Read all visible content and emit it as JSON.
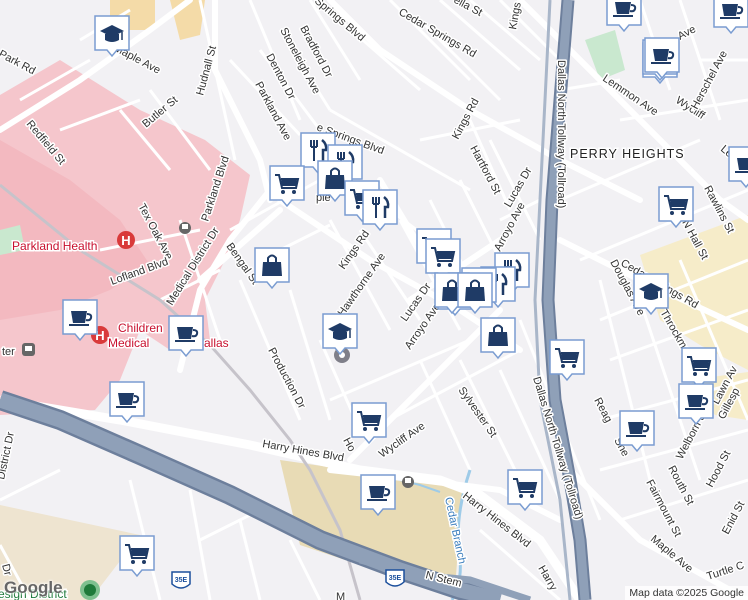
{
  "streets": {
    "cedar_springs_rd": "Cedar Springs Rd",
    "cedar_springs_rd_2": "Cedar Springs Rd",
    "dallas_north_tollway": "Dallas North Tollway (Tollroad)",
    "dallas_north_tollway_2": "Dallas North Tollway (Tollroad)",
    "harry_hines_blvd": "Harry Hines Blvd",
    "harry_hines_blvd_2": "Harry Hines Blvd",
    "harry_hines_blvd_3": "Harry",
    "maple_ave": "Maple Ave",
    "maple_ave_2": "Maple Ave",
    "lemmon_ave": "Lemmon Ave",
    "lemmon_ave_2": "Lem",
    "wycliff_ave": "Wycliff Ave",
    "wycliff_ave_2": "Wycliff",
    "kings_rd": "Kings Rd",
    "kings_rd_2": "Kings Rd",
    "kings_rd_3": "Kings R",
    "hawthorne_ave": "Hawthorne Ave",
    "lucas_dr": "Lucas Dr",
    "lucas_dr_2": "Lucas Dr",
    "arroyo_ave": "Arroyo Ave",
    "arroyo_ave_2": "Arroyo Ave",
    "sylvester_st": "Sylvester St",
    "production_dr": "Production Dr",
    "medical_district_dr": "Medical District Dr",
    "bengal_st": "Bengal St",
    "parkland_blvd": "Parkland Blvd",
    "parkland_ave": "Parkland Ave",
    "tex_oak_ave": "Tex Oak Ave",
    "lofland_blvd": "Lofland Blvd",
    "butler_st": "Butler St",
    "redfield_st": "Redfield St",
    "hudnall_st": "Hudnall St",
    "denton_dr": "Denton Dr",
    "stoneleigh_ave": "Stoneleigh Ave",
    "bradford_dr": "Bradford Dr",
    "springs_blvd": "Springs Blvd",
    "springs_blvd_2": "e Springs Blvd",
    "hartford_st": "Hartford St",
    "rawlins_st": "Rawlins St",
    "herschel_ave": "Herschel Ave",
    "douglas_ave": "Douglas Ave",
    "throckmorton_st": "Throckmorton St",
    "hall_st": "N Hall St",
    "reagan_st": "Reag",
    "welborn_st": "Welborn St",
    "routh_st": "Routh St",
    "hood_st": "Hood St",
    "fairmount_st": "Fairmount St",
    "enid_st": "Enid St",
    "turtle_creek": "Turtle C",
    "n_stemmons": "N Stem",
    "gillespie_st": "Gillesp",
    "lawn_ave": "Lawn Av",
    "sheridan_st": "She",
    "ho_st": "Ho",
    "ella_st": "ella St",
    "ave_top": "Ave",
    "park_rd": "Park Rd",
    "district_dr": "District Dr",
    "ter": "ter",
    "ple": "ple",
    "sign_district": "esign District",
    "dr_fragment": "Dr",
    "m_fragment": "M"
  },
  "areas": {
    "perry_heights": "PERRY HEIGHTS",
    "parkland_health": "Parkland Health",
    "childrens_medical": "Children's Medical Dallas",
    "childrens_line1": "Children",
    "childrens_line2": "Medical",
    "childrens_line3": "allas",
    "cedar_branch": "Cedar Branch",
    "google": "Google"
  },
  "shields": {
    "i35e_1": "35E",
    "i35e_2": "35E"
  },
  "markers": [
    {
      "type": "school",
      "icon": "graduation-cap-icon"
    },
    {
      "type": "coffee",
      "icon": "coffee-cup-icon"
    },
    {
      "type": "coffee",
      "icon": "coffee-cup-icon"
    },
    {
      "type": "shopping",
      "icon": "shopping-bag-icon"
    },
    {
      "type": "restaurant",
      "icon": "fork-knife-icon"
    },
    {
      "type": "grocery",
      "icon": "shopping-cart-icon"
    },
    {
      "type": "restaurant",
      "icon": "fork-knife-icon"
    },
    {
      "type": "shopping",
      "icon": "shopping-bag-icon"
    },
    {
      "type": "grocery",
      "icon": "shopping-cart-icon"
    },
    {
      "type": "restaurant",
      "icon": "fork-knife-icon"
    },
    {
      "type": "grocery",
      "icon": "shopping-cart-icon"
    },
    {
      "type": "restaurant",
      "icon": "fork-knife-icon"
    },
    {
      "type": "coffee",
      "icon": "coffee-cup-icon"
    },
    {
      "type": "coffee",
      "icon": "coffee-cup-icon"
    },
    {
      "type": "grocery",
      "icon": "shopping-cart-icon"
    },
    {
      "type": "shopping",
      "icon": "shopping-bag-icon"
    },
    {
      "type": "coffee",
      "icon": "coffee-cup-icon"
    },
    {
      "type": "coffee",
      "icon": "coffee-cup-icon"
    },
    {
      "type": "school",
      "icon": "graduation-cap-icon"
    },
    {
      "type": "shopping",
      "icon": "shopping-bag-icon"
    },
    {
      "type": "restaurant",
      "icon": "fork-knife-icon"
    },
    {
      "type": "restaurant",
      "icon": "fork-knife-icon"
    },
    {
      "type": "shopping",
      "icon": "shopping-bag-icon"
    },
    {
      "type": "shopping",
      "icon": "shopping-bag-icon"
    },
    {
      "type": "grocery",
      "icon": "shopping-cart-icon"
    },
    {
      "type": "school",
      "icon": "graduation-cap-icon"
    },
    {
      "type": "grocery",
      "icon": "shopping-cart-icon"
    },
    {
      "type": "coffee",
      "icon": "coffee-cup-icon"
    },
    {
      "type": "coffee",
      "icon": "coffee-cup-icon"
    },
    {
      "type": "grocery",
      "icon": "shopping-cart-icon"
    },
    {
      "type": "grocery",
      "icon": "shopping-cart-icon"
    },
    {
      "type": "coffee",
      "icon": "coffee-cup-icon"
    },
    {
      "type": "grocery",
      "icon": "shopping-cart-icon"
    },
    {
      "type": "coffee",
      "icon": "coffee-cup-icon"
    },
    {
      "type": "grocery",
      "icon": "shopping-cart-icon"
    },
    {
      "type": "coffee",
      "icon": "coffee-cup-icon"
    },
    {
      "type": "coffee",
      "icon": "coffee-cup-icon"
    }
  ],
  "attribution": "Map data ©2025 Google",
  "colors": {
    "background": "#f2f1f4",
    "hospital_area": "#f5c6cc",
    "industrial": "#f1e6b8",
    "campus": "#e9dfc0",
    "park": "#c9e8cf",
    "highway": "#8fa0b8",
    "highway_casing": "#7a8aa3",
    "arterial": "#ffffff",
    "marker_fill": "#ffffff",
    "marker_border": "#7a9cd1",
    "marker_icon": "#1f3b66",
    "hospital_red": "#d93a3a"
  }
}
